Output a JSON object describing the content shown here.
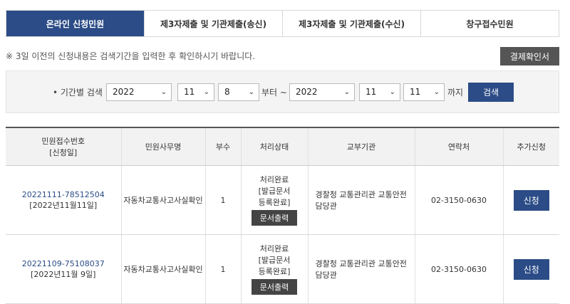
{
  "tabs": [
    {
      "label": "온라인 신청민원",
      "active": true
    },
    {
      "label": "제3자제출 및 기관제출(송신)",
      "active": false
    },
    {
      "label": "제3자제출 및 기관제출(수신)",
      "active": false
    },
    {
      "label": "창구접수민원",
      "active": false
    }
  ],
  "notice": "※ 3일 이전의 신청내용은 검색기간을 입력한 후 확인하시기 바랍니다.",
  "receipt_button": "결제확인서",
  "search": {
    "label": "• 기간별 검색",
    "start_year": "2022",
    "start_month": "11",
    "start_day": "8",
    "from_text": "부터 ~",
    "end_year": "2022",
    "end_month": "11",
    "end_day": "11",
    "until_text": "까지",
    "button": "검색"
  },
  "table": {
    "headers": {
      "number_line1": "민원접수번호",
      "number_line2": "[신청일]",
      "task": "민원사무명",
      "copies": "부수",
      "status": "처리상태",
      "agency": "교부기관",
      "contact": "연락처",
      "extra": "추가신청"
    },
    "rows": [
      {
        "number": "20221111-78512504",
        "date": "[2022년11월11일]",
        "task": "자동차교통사고사실확인",
        "copies": "1",
        "status1": "처리완료",
        "status2": "[발급문서",
        "status3": "등록완료]",
        "print_button": "문서출력",
        "agency": "경찰청 교통관리관 교통안전담당관",
        "contact": "02-3150-0630",
        "apply_button": "신청"
      },
      {
        "number": "20221109-75108037",
        "date": "[2022년11월 9일]",
        "task": "자동차교통사고사실확인",
        "copies": "1",
        "status1": "처리완료",
        "status2": "[발급문서",
        "status3": "등록완료]",
        "print_button": "문서출력",
        "agency": "경찰청 교통관리관 교통안전담당관",
        "contact": "02-3150-0630",
        "apply_button": "신청"
      }
    ]
  },
  "colors": {
    "primary": "#2b4c86",
    "dark_button": "#444444"
  },
  "icons": {
    "select_arrow": "chevron-down-icon"
  }
}
